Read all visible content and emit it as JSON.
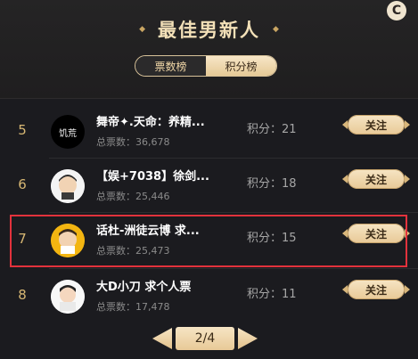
{
  "header": {
    "title": "最佳男新人",
    "refresh_symbol": "C"
  },
  "tabs": [
    {
      "label": "票数榜",
      "active": true
    },
    {
      "label": "积分榜",
      "active": false
    }
  ],
  "list": [
    {
      "rank": "5",
      "name": "舞帝✦.天命：养精...",
      "votes_label": "总票数：36,678",
      "score_label": "积分：21",
      "button": "关注",
      "avatar_text": "饥荒"
    },
    {
      "rank": "6",
      "name": "【娱+7038】徐剑...",
      "votes_label": "总票数：25,446",
      "score_label": "积分：18",
      "button": "关注",
      "avatar_text": ""
    },
    {
      "rank": "7",
      "name": "话杜-洲徒云博 求...",
      "votes_label": "总票数：25,473",
      "score_label": "积分：15",
      "button": "关注",
      "avatar_text": ""
    },
    {
      "rank": "8",
      "name": "大D小刀 求个人票",
      "votes_label": "总票数：17,478",
      "score_label": "积分：11",
      "button": "关注",
      "avatar_text": ""
    }
  ],
  "pager": {
    "label": "2/4"
  },
  "colors": {
    "gold": "#d7b773",
    "highlight": "#e2323c"
  }
}
